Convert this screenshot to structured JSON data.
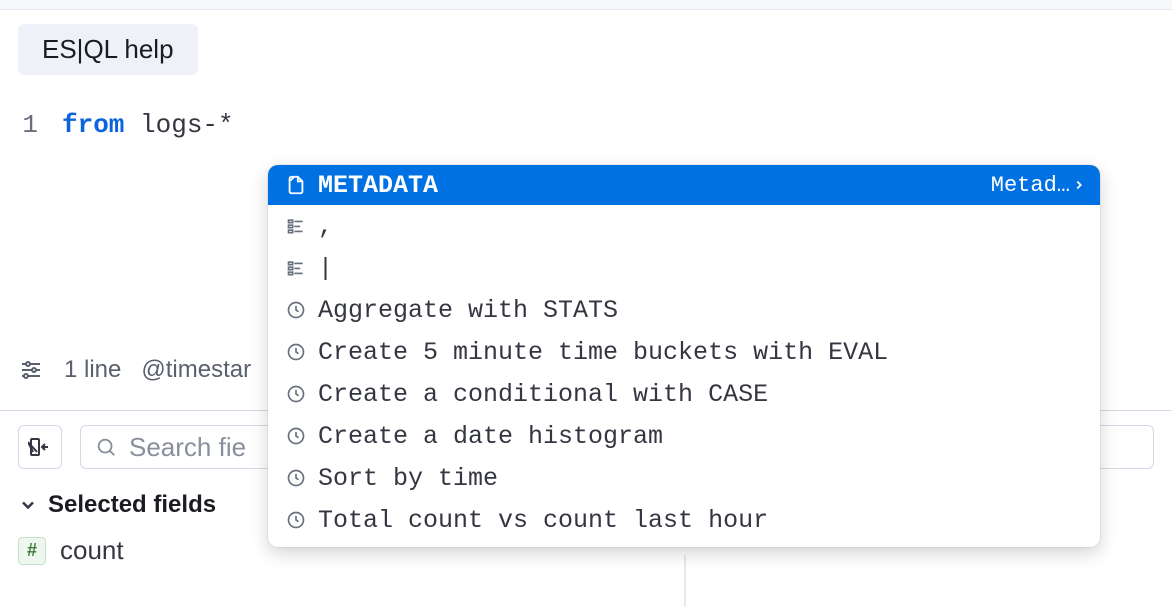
{
  "help_button": {
    "label": "ES|QL help"
  },
  "editor": {
    "line_number": "1",
    "keyword": "from",
    "rest": " logs-*"
  },
  "autocomplete": {
    "selected": {
      "label": "METADATA",
      "meta": "Metad…"
    },
    "items": [
      {
        "icon": "list-icon",
        "label": ","
      },
      {
        "icon": "list-icon",
        "label": "|"
      },
      {
        "icon": "clock-icon",
        "label": "Aggregate with STATS"
      },
      {
        "icon": "clock-icon",
        "label": "Create 5 minute time buckets with EVAL"
      },
      {
        "icon": "clock-icon",
        "label": "Create a conditional with CASE"
      },
      {
        "icon": "clock-icon",
        "label": "Create a date histogram"
      },
      {
        "icon": "clock-icon",
        "label": "Sort by time"
      },
      {
        "icon": "clock-icon",
        "label": "Total count vs count last hour"
      }
    ]
  },
  "status_bar": {
    "lines": "1 line",
    "timestamp_field": "@timestar"
  },
  "search": {
    "placeholder": "Search fie"
  },
  "fields_section": {
    "title": "Selected fields"
  },
  "fields": [
    {
      "type_badge": "#",
      "name": "count"
    }
  ]
}
